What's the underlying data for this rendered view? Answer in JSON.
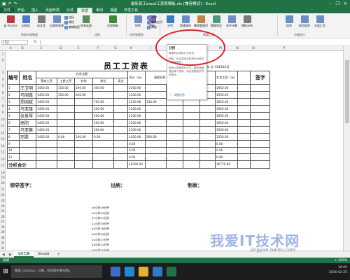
{
  "window": {
    "title": "最新员工excel工资表模板.xls [兼容模式] - Excel",
    "minimize": "–",
    "restore": "❐",
    "close": "✕"
  },
  "ribbon_tabs": [
    "文件",
    "开始",
    "插入",
    "页面布局",
    "公式",
    "数据",
    "审阅",
    "视图",
    "开发工具"
  ],
  "active_tab": "数据",
  "ribbon": {
    "buttons": [
      {
        "label": "自 Access",
        "color": "#b33b3b"
      },
      {
        "label": "自网站",
        "color": "#4a7bc4"
      },
      {
        "label": "自文本",
        "color": "#7a7a7a"
      },
      {
        "label": "自其他来源",
        "color": "#6a8fc8"
      },
      {
        "label": "现有连接",
        "color": "#5b8a5b"
      },
      {
        "label": "全部刷新",
        "color": "#3d8a3d"
      },
      {
        "label": "排序",
        "color": "#6a8fc8"
      },
      {
        "label": "筛选",
        "color": "#8a6abf"
      },
      {
        "label": "分列",
        "color": "#3d7bbf"
      },
      {
        "label": "快速填充",
        "color": "#6a8fc8"
      },
      {
        "label": "删除重复项",
        "color": "#c4824a"
      },
      {
        "label": "数据验证",
        "color": "#4a9a7a"
      },
      {
        "label": "合并计算",
        "color": "#6a8fc8"
      },
      {
        "label": "模拟分析",
        "color": "#7a7a7a"
      },
      {
        "label": "组合",
        "color": "#6a8fc8"
      },
      {
        "label": "取消组合",
        "color": "#6a8fc8"
      },
      {
        "label": "分类汇总",
        "color": "#6a8fc8"
      }
    ],
    "small_buttons": [
      "连接",
      "属性",
      "编辑链接",
      "清除",
      "重新应用",
      "高级"
    ],
    "groups": [
      "获取外部数据",
      "连接",
      "排序和筛选",
      "数据工具",
      "分级显示"
    ]
  },
  "formula_bar": {
    "name_box": "I32",
    "fx": "fx",
    "value": ""
  },
  "columns": [
    "A",
    "B",
    "C",
    "D",
    "E",
    "F",
    "G",
    "H",
    "I",
    "J",
    "K",
    "L",
    "M",
    "N",
    "O",
    "P"
  ],
  "rows": [
    "1",
    "2",
    "3",
    "4",
    "5",
    "6",
    "7",
    "8",
    "9",
    "10",
    "11",
    "12",
    "13",
    "14",
    "15",
    "16",
    "17",
    "18",
    "19",
    "20",
    "21",
    "22",
    "23",
    "24",
    "25",
    "26",
    "27",
    "28",
    "29",
    "30",
    "31",
    "32",
    "33",
    "34",
    "35",
    "36",
    "37",
    "38"
  ],
  "sheet": {
    "title": "员工工资表",
    "unit_line": "单位：三川国际集团   年   月    ·2015年1月",
    "header": {
      "no": "编号",
      "name": "姓名",
      "group": "应发金额",
      "base": "基本工资",
      "seniority": "工龄工资",
      "subsidy": "补助",
      "position": "岗位",
      "bonus": "奖金",
      "total": "合计（元）",
      "deduct": "请假扣款（元）",
      "actual": "实发工资（元）",
      "sign": "签字"
    },
    "employees": [
      {
        "no": "1",
        "name": "王卫明",
        "base": "1450.00",
        "seniority": "150.00",
        "subsidy": "200.00",
        "position": "300.00",
        "bonus": "",
        "total": "2100.00",
        "deduct": "",
        "actual": "1950.00"
      },
      {
        "no": "2",
        "name": "马国鑫",
        "base": "1450.00",
        "seniority": "150.00",
        "subsidy": "200.00",
        "position": "",
        "bonus": "",
        "total": "2100.00",
        "deduct": "",
        "actual": "1950.00"
      },
      {
        "no": "3",
        "name": "郑国斌",
        "base": "1450.00",
        "seniority": "",
        "subsidy": "",
        "position": "700.00",
        "bonus": "",
        "total": "2150.00",
        "deduct": "330.00",
        "actual": "1820.00"
      },
      {
        "no": "4",
        "name": "马亚雄",
        "base": "1450.00",
        "seniority": "",
        "subsidy": "",
        "position": "200.00",
        "bonus": "",
        "total": "2100.00",
        "deduct": "",
        "actual": "1950.00"
      },
      {
        "no": "5",
        "name": "张景琴",
        "base": "1450.00",
        "seniority": "",
        "subsidy": "",
        "position": "200.00",
        "bonus": "",
        "total": "2100.00",
        "deduct": "",
        "actual": "1950.00"
      },
      {
        "no": "6",
        "name": "高阳",
        "base": "1450.00",
        "seniority": "",
        "subsidy": "",
        "position": "200.00",
        "bonus": "",
        "total": "2100.00",
        "deduct": "",
        "actual": "1950.00"
      },
      {
        "no": "7",
        "name": "马亚蓉",
        "base": "1450.00",
        "seniority": "",
        "subsidy": "",
        "position": "200.00",
        "bonus": "",
        "total": "2100.00",
        "deduct": "",
        "actual": "1950.00"
      },
      {
        "no": "8",
        "name": "邓霞",
        "base": "1450.00",
        "seniority": "0.00",
        "subsidy": "100.00",
        "position": "0.00",
        "bonus": "",
        "total": "1450.00",
        "deduct": "200.00",
        "actual": "1250.00"
      },
      {
        "no": "9",
        "name": "",
        "base": "",
        "seniority": "",
        "subsidy": "",
        "position": "",
        "bonus": "",
        "total": "0.00",
        "deduct": "",
        "actual": "0.00"
      },
      {
        "no": "10",
        "name": "",
        "base": "",
        "seniority": "",
        "subsidy": "",
        "position": "",
        "bonus": "",
        "total": "0.00",
        "deduct": "",
        "actual": "0.00"
      },
      {
        "no": "11",
        "name": "",
        "base": "",
        "seniority": "",
        "subsidy": "",
        "position": "",
        "bonus": "",
        "total": "0.00",
        "deduct": "",
        "actual": "0.00"
      }
    ],
    "total_row": {
      "label": "分栏合计",
      "total": "18300.00",
      "actual": "16770.00"
    },
    "signatures": {
      "leader": "领导签字：",
      "cashier": "出纳：",
      "maker": "制表："
    },
    "time_list": [
      "56小时49分钟",
      "50小时25分钟",
      "32小时51分钟",
      "41小时39分钟",
      "45小时38分钟",
      "48小时26分钟",
      "51小时37分钟",
      "34小时41分钟",
      "48小时30分钟",
      "32小时05分钟",
      "44小时39分钟",
      "34小时51分钟",
      "41小时37分钟",
      "57小时12分钟",
      "53小时43分钟"
    ]
  },
  "popup": {
    "title": "分列",
    "p1": "将单列文本拆分为多列。",
    "p2": "例如，可以将全名列拆分为姓氏列和名字列。",
    "p3": "您可以选择拆分方式：固定宽度或在每个逗号、句点或其他字符处拆分。",
    "more": "详细信息"
  },
  "sheet_tabs": [
    "5月工资",
    "Sheet3"
  ],
  "active_sheet": "5月工资",
  "add_sheet": "+",
  "status": {
    "left": "就绪",
    "right": "+ 100%"
  },
  "taskbar": {
    "cortana": "我是 Cortana，小娜。有问题尽管问我。",
    "time": "16:05",
    "date": "2016-02-25"
  },
  "watermark": {
    "main": "我爱IT技术网",
    "sub": "jingyan.baidu.com"
  }
}
